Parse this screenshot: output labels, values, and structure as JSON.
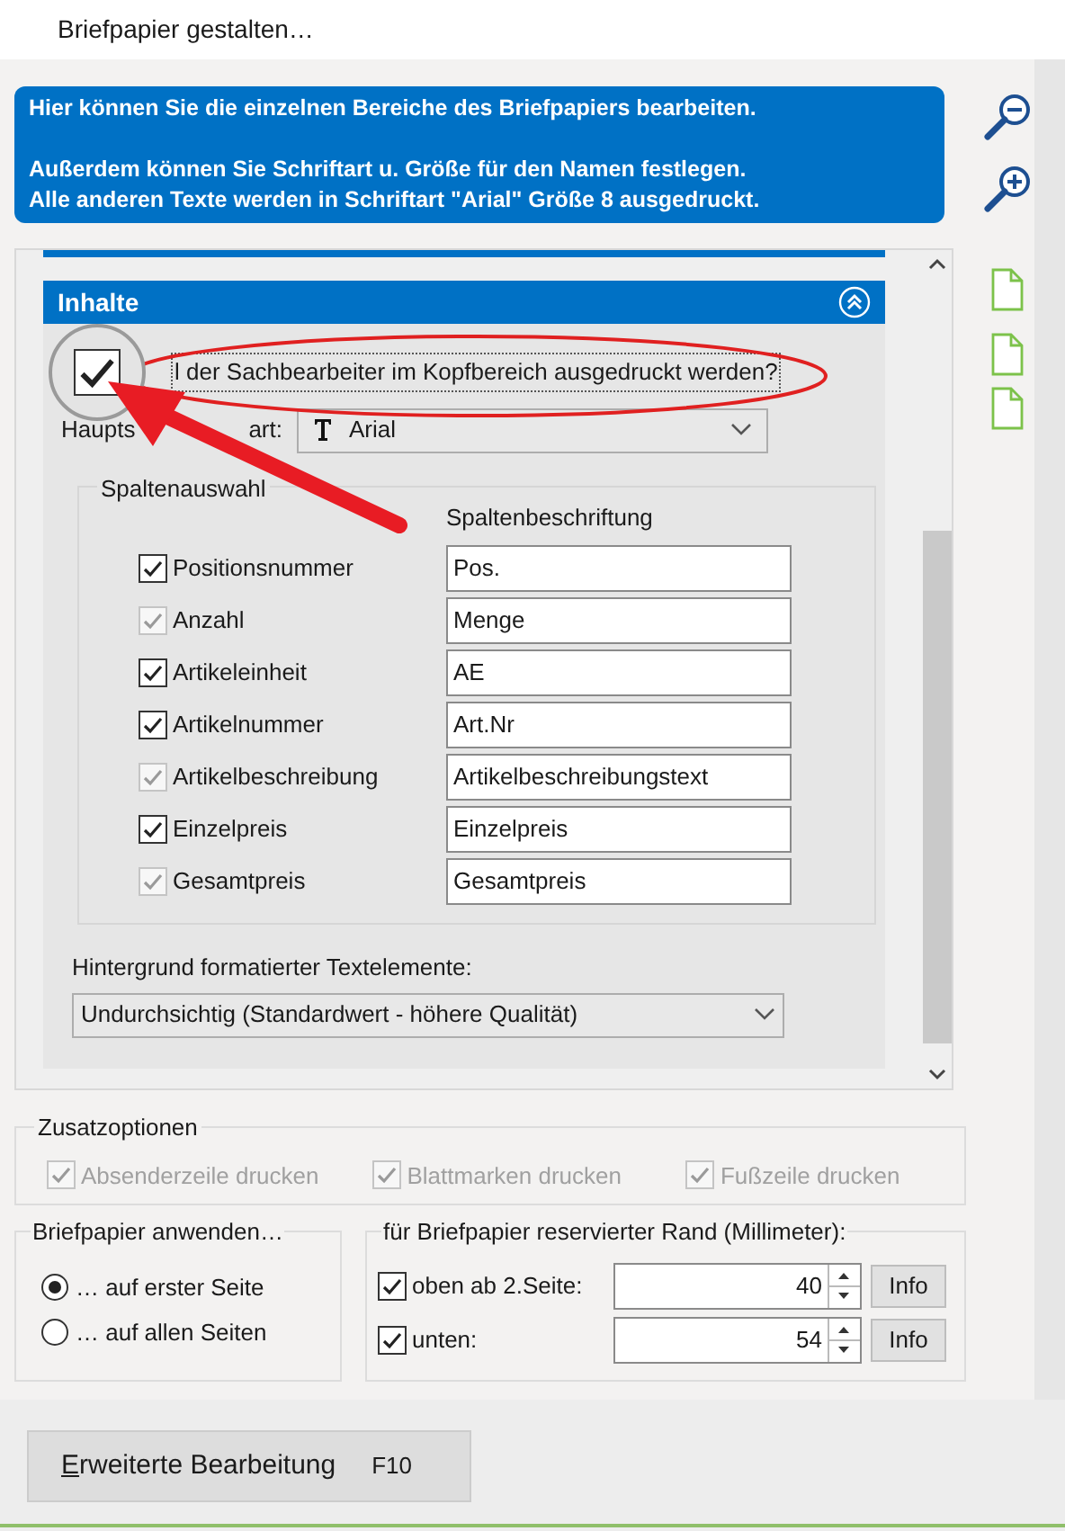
{
  "window": {
    "title": "Briefpapier gestalten…"
  },
  "info_box": {
    "paragraphs": [
      [
        "Hier können Sie die einzelnen Bereiche des Briefpapiers bearbeiten."
      ],
      [
        "Außerdem können Sie Schriftart u. Größe für den Namen festlegen.",
        "Alle anderen Texte werden in Schriftart \"Arial\" Größe 8 ausgedruckt."
      ]
    ]
  },
  "section": {
    "title": "Inhalte",
    "expanded": true
  },
  "print_clerk": {
    "label": "l der Sachbearbeiter im Kopfbereich ausgedruckt werden?",
    "checked": true
  },
  "font": {
    "label_parts": [
      "Haupts",
      "art:"
    ],
    "value": "Arial"
  },
  "columns": {
    "title": "Spaltenauswahl",
    "header": "Spaltenbeschriftung",
    "rows": [
      {
        "label": "Positionsnummer",
        "checked": true,
        "disabled": false,
        "caption": "Pos."
      },
      {
        "label": "Anzahl",
        "checked": true,
        "disabled": true,
        "caption": "Menge"
      },
      {
        "label": "Artikeleinheit",
        "checked": true,
        "disabled": false,
        "caption": "AE"
      },
      {
        "label": "Artikelnummer",
        "checked": true,
        "disabled": false,
        "caption": "Art.Nr"
      },
      {
        "label": "Artikelbeschreibung",
        "checked": true,
        "disabled": true,
        "caption": "Artikelbeschreibungstext"
      },
      {
        "label": "Einzelpreis",
        "checked": true,
        "disabled": false,
        "caption": "Einzelpreis"
      },
      {
        "label": "Gesamtpreis",
        "checked": true,
        "disabled": true,
        "caption": "Gesamtpreis"
      }
    ]
  },
  "background": {
    "label": "Hintergrund formatierter Textelemente:",
    "value": "Undurchsichtig (Standardwert - höhere Qualität)"
  },
  "extra_options": {
    "title": "Zusatzoptionen",
    "items": [
      {
        "label": "Absenderzeile drucken",
        "checked": true,
        "disabled": true
      },
      {
        "label": "Blattmarken drucken",
        "checked": true,
        "disabled": true
      },
      {
        "label": "Fußzeile drucken",
        "checked": true,
        "disabled": true
      }
    ]
  },
  "apply": {
    "title": "Briefpapier anwenden…",
    "options": [
      {
        "label": "… auf erster Seite",
        "selected": true
      },
      {
        "label": "… auf allen Seiten",
        "selected": false
      }
    ]
  },
  "margin": {
    "title": "für Briefpapier reservierter Rand (Millimeter):",
    "rows": [
      {
        "label": "oben ab 2.Seite:",
        "checked": true,
        "value": "40",
        "button": "Info"
      },
      {
        "label": "unten:",
        "checked": true,
        "value": "54",
        "button": "Info"
      }
    ]
  },
  "footer_button": {
    "label": "Erweiterte Bearbeitung",
    "shortcut": "F10"
  }
}
